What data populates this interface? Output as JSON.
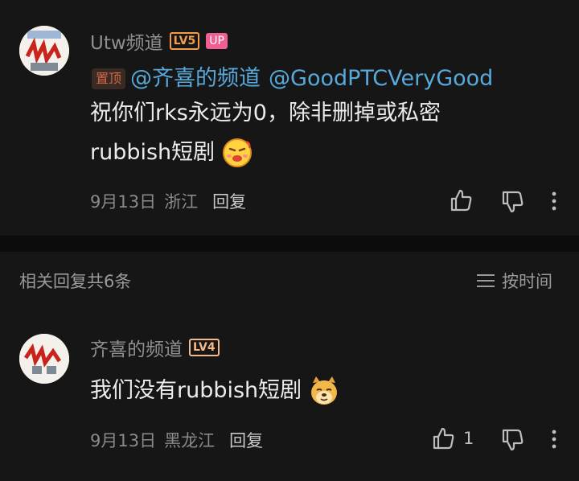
{
  "top_comment": {
    "username": "Utw频道",
    "level": "LV5",
    "up_badge": "UP",
    "pinned_label": "置顶",
    "mentions": [
      "@齐喜的频道",
      "@GoodPTCVeryGood"
    ],
    "line2": "祝你们rks永远为0，除非删掉或私密",
    "line3": "rubbish短剧",
    "emoji": "pouting-emoji",
    "date": "9月13日",
    "location": "浙江",
    "reply_label": "回复"
  },
  "replies_header": {
    "count_label": "相关回复共6条",
    "sort_label": "按时间"
  },
  "reply": {
    "username": "齐喜的频道",
    "level": "LV4",
    "text": "我们没有rubbish短剧",
    "emoji": "doge-emoji",
    "date": "9月13日",
    "location": "黑龙江",
    "reply_label": "回复",
    "like_count": "1"
  },
  "colors": {
    "background": "#161616",
    "mention": "#57a9d9",
    "level_badge": "#f39c4a",
    "up_badge": "#f05e93",
    "pinned": "#cf6a4a"
  }
}
